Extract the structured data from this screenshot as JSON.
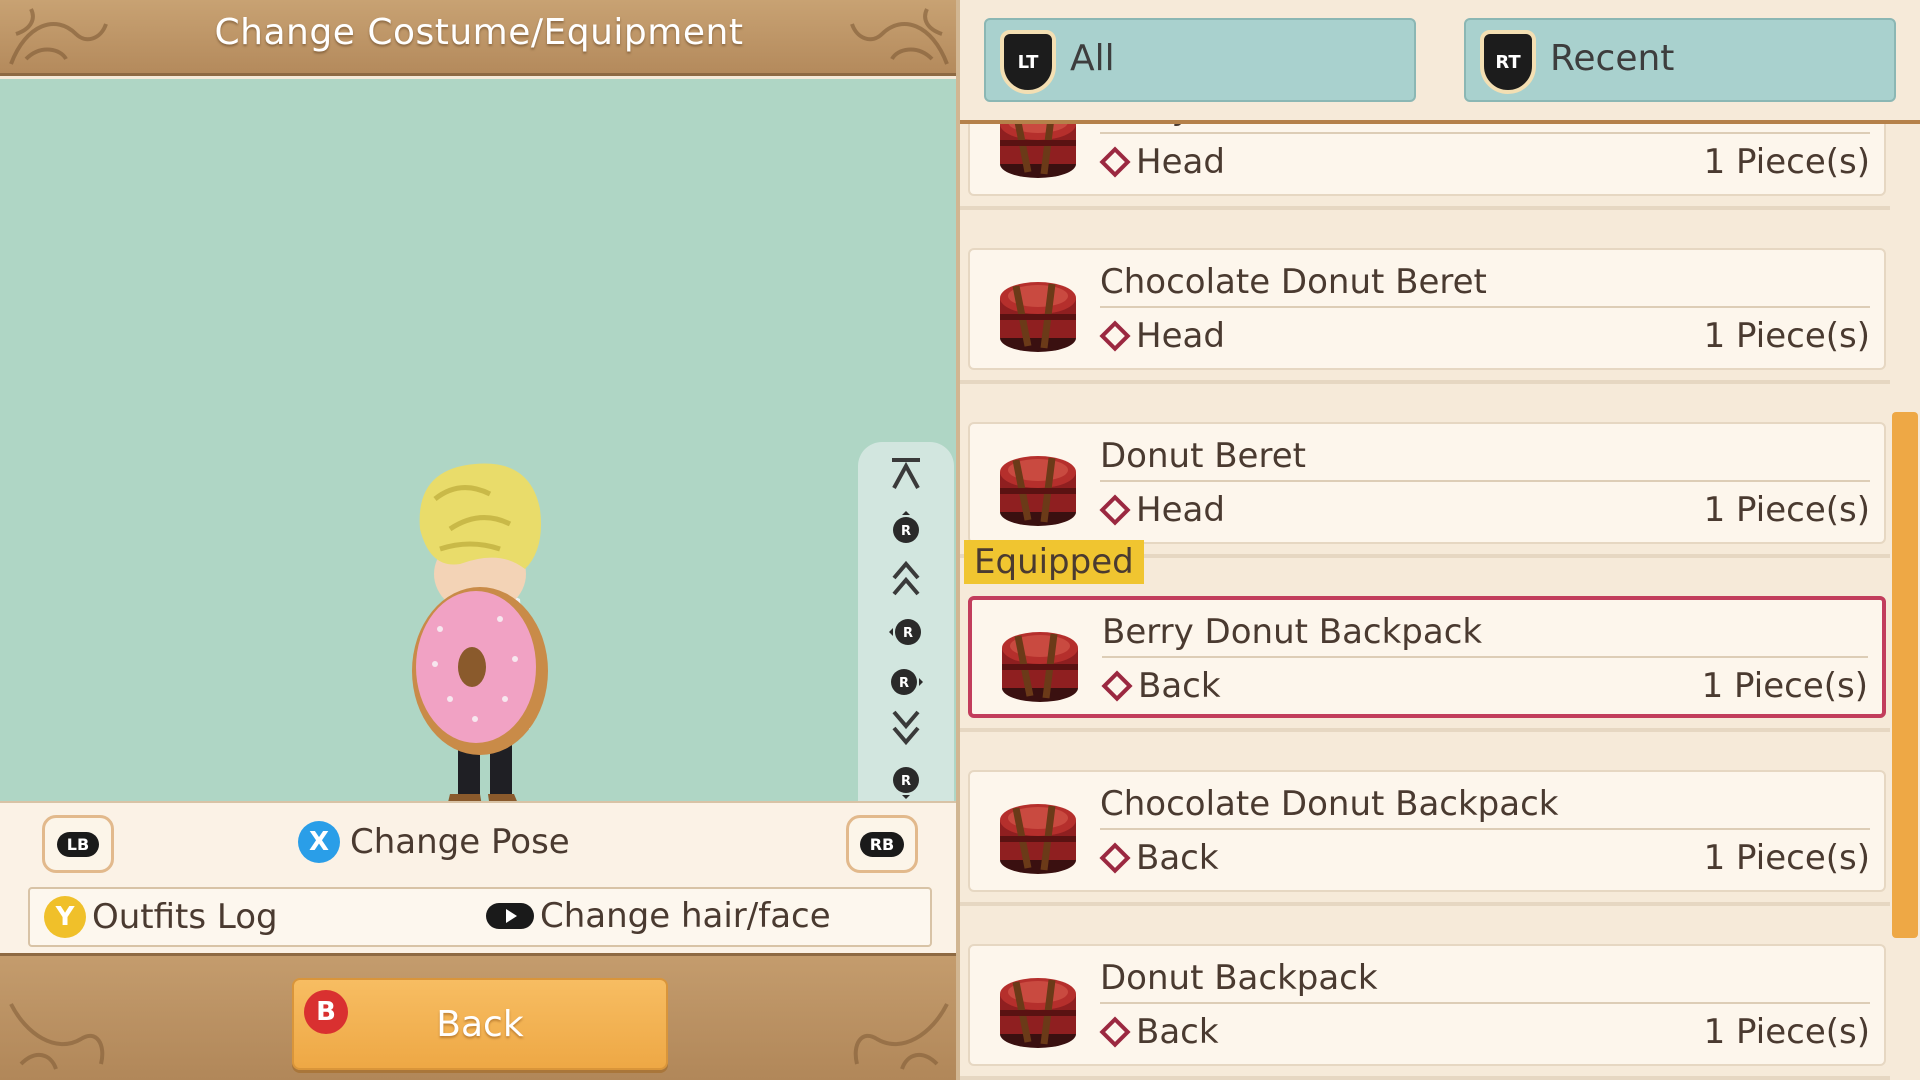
{
  "title": "Change Costume/Equipment",
  "controls": {
    "lb_label": "LB",
    "rb_label": "RB",
    "x_label": "X",
    "change_pose": "Change Pose",
    "y_label": "Y",
    "outfits_log": "Outfits Log",
    "change_hair_face": "Change hair/face",
    "b_label": "B",
    "back": "Back"
  },
  "rs_guide": [
    "top-arrow-icon",
    "rs-up-icon",
    "double-up-icon",
    "rs-left-icon",
    "rs-right-icon",
    "double-down-icon",
    "rs-down-icon",
    "bottom-arrow-icon"
  ],
  "tabs": [
    {
      "button": "LT",
      "label": "All"
    },
    {
      "button": "RT",
      "label": "Recent"
    }
  ],
  "items": [
    {
      "name": "Berry Donut Beret",
      "slot": "Head",
      "qty": "1 Piece(s)",
      "equipped": false
    },
    {
      "name": "Chocolate Donut Beret",
      "slot": "Head",
      "qty": "1 Piece(s)",
      "equipped": false
    },
    {
      "name": "Donut Beret",
      "slot": "Head",
      "qty": "1 Piece(s)",
      "equipped": false
    },
    {
      "name": "Berry Donut Backpack",
      "slot": "Back",
      "qty": "1 Piece(s)",
      "equipped": true
    },
    {
      "name": "Chocolate Donut Backpack",
      "slot": "Back",
      "qty": "1 Piece(s)",
      "equipped": false
    },
    {
      "name": "Donut Backpack",
      "slot": "Back",
      "qty": "1 Piece(s)",
      "equipped": false
    }
  ],
  "equipped_label": "Equipped",
  "colors": {
    "viewport": "#afd6c5",
    "tab": "#a9d1ce",
    "accent_orange": "#eea845",
    "equipped_border": "#c23d5c",
    "equipped_badge": "#f0c530"
  }
}
